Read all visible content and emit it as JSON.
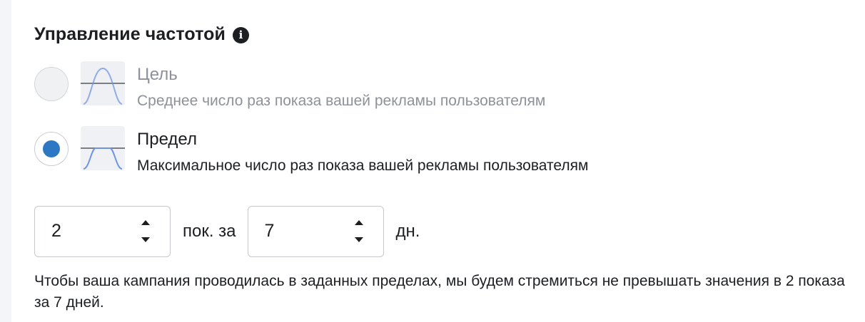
{
  "section": {
    "title": "Управление частотой"
  },
  "options": [
    {
      "id": "goal",
      "title": "Цель",
      "description": "Среднее число раз показа вашей рекламы пользователям",
      "selected": false
    },
    {
      "id": "cap",
      "title": "Предел",
      "description": "Максимальное число раз показа вашей рекламы пользователям",
      "selected": true
    }
  ],
  "frequency": {
    "impressions_value": "2",
    "separator_label": "пок. за",
    "days_value": "7",
    "unit_label": "дн."
  },
  "note": "Чтобы ваша кампания проводилась в заданных пределах, мы будем стремиться не превышать значения в 2 показа за 7 дней.",
  "colors": {
    "accent": "#2d78c4",
    "curve": "#6f95e2",
    "text_primary": "#1c1e21",
    "text_muted": "#8d9199"
  },
  "icons": {
    "info": "info-icon",
    "goal_curve": "bell-curve-icon",
    "cap_curve": "capped-curve-icon",
    "stepper": "up-down-arrows-icon"
  }
}
